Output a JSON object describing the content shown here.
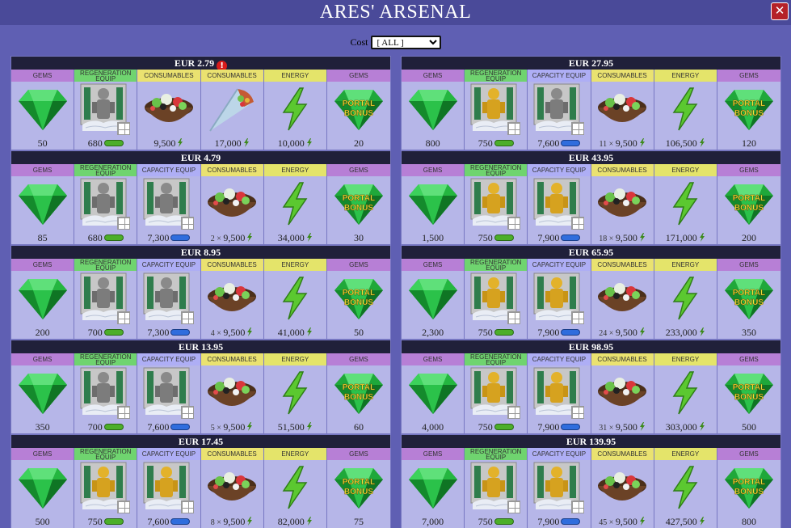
{
  "window": {
    "title": "ARES' ARSENAL",
    "close_glyph": "✕"
  },
  "filter": {
    "label": "Cost",
    "options": [
      "[ ALL ]"
    ],
    "selected": "[ ALL ]"
  },
  "columns": [
    {
      "kind": "gems",
      "label": "GEMS"
    },
    {
      "kind": "regen",
      "label": "REGENERATION EQUIP"
    },
    {
      "kind": "capacity",
      "label": "CAPACITY EQUIP"
    },
    {
      "kind": "consumables",
      "label": "CONSUMABLES"
    },
    {
      "kind": "energy",
      "label": "ENERGY"
    },
    {
      "kind": "portal",
      "label": "GEMS"
    }
  ],
  "portal_text": "PORTAL BONUS",
  "colors": {
    "header": "#20203a",
    "gems_head": "#b77fd6",
    "regen_head": "#6fd46f",
    "capacity_head": "#aeaef5",
    "consumables_head": "#eae270",
    "energy_head": "#e4e46a",
    "pill_green": "#4cae2a",
    "pill_blue": "#2f6ddd"
  },
  "bundles": [
    {
      "price": "EUR 2.79",
      "alert": "!",
      "layout": "special",
      "cells": [
        {
          "kind": "gems",
          "label": "GEMS",
          "value": "50",
          "icon": "gem-icon"
        },
        {
          "kind": "regen",
          "label": "REGENERATION EQUIP",
          "value": "680",
          "icon": "statue-silver-icon",
          "suffix": "pill-green"
        },
        {
          "kind": "consumables",
          "label": "CONSUMABLES",
          "value": "9,500",
          "icon": "salad-bowl-icon",
          "suffix": "bolt"
        },
        {
          "kind": "consumables",
          "label": "CONSUMABLES",
          "value": "17,000",
          "icon": "wrap-icon",
          "suffix": "bolt"
        },
        {
          "kind": "energy",
          "label": "ENERGY",
          "value": "10,000",
          "icon": "bolt-icon",
          "suffix": "bolt"
        },
        {
          "kind": "portal",
          "label": "GEMS",
          "value": "20",
          "icon": "portal-gem-icon"
        }
      ]
    },
    {
      "price": "EUR 27.95",
      "cells": [
        {
          "kind": "gems",
          "label": "GEMS",
          "value": "800",
          "icon": "gem-icon"
        },
        {
          "kind": "regen",
          "label": "REGENERATION EQUIP",
          "value": "750",
          "icon": "statue-gold-icon",
          "suffix": "pill-green"
        },
        {
          "kind": "capacity",
          "label": "CAPACITY EQUIP",
          "value": "7,600",
          "icon": "statue-silver-icon",
          "suffix": "pill-blue"
        },
        {
          "kind": "consumables",
          "label": "CONSUMABLES",
          "mult": "11 ×",
          "value": "9,500",
          "icon": "salad-bowl-icon",
          "suffix": "bolt"
        },
        {
          "kind": "energy",
          "label": "ENERGY",
          "value": "106,500",
          "icon": "bolt-icon",
          "suffix": "bolt"
        },
        {
          "kind": "portal",
          "label": "GEMS",
          "value": "120",
          "icon": "portal-gem-icon"
        }
      ]
    },
    {
      "price": "EUR 4.79",
      "cells": [
        {
          "kind": "gems",
          "label": "GEMS",
          "value": "85",
          "icon": "gem-icon"
        },
        {
          "kind": "regen",
          "label": "REGENERATION EQUIP",
          "value": "680",
          "icon": "statue-silver-icon",
          "suffix": "pill-green"
        },
        {
          "kind": "capacity",
          "label": "CAPACITY EQUIP",
          "value": "7,300",
          "icon": "statue-silver-icon",
          "suffix": "pill-blue"
        },
        {
          "kind": "consumables",
          "label": "CONSUMABLES",
          "mult": "2 ×",
          "value": "9,500",
          "icon": "salad-bowl-icon",
          "suffix": "bolt"
        },
        {
          "kind": "energy",
          "label": "ENERGY",
          "value": "34,000",
          "icon": "bolt-icon",
          "suffix": "bolt"
        },
        {
          "kind": "portal",
          "label": "GEMS",
          "value": "30",
          "icon": "portal-gem-icon"
        }
      ]
    },
    {
      "price": "EUR 43.95",
      "cells": [
        {
          "kind": "gems",
          "label": "GEMS",
          "value": "1,500",
          "icon": "gem-icon"
        },
        {
          "kind": "regen",
          "label": "REGENERATION EQUIP",
          "value": "750",
          "icon": "statue-gold-icon",
          "suffix": "pill-green"
        },
        {
          "kind": "capacity",
          "label": "CAPACITY EQUIP",
          "value": "7,900",
          "icon": "statue-gold-icon",
          "suffix": "pill-blue"
        },
        {
          "kind": "consumables",
          "label": "CONSUMABLES",
          "mult": "18 ×",
          "value": "9,500",
          "icon": "salad-bowl-icon",
          "suffix": "bolt"
        },
        {
          "kind": "energy",
          "label": "ENERGY",
          "value": "171,000",
          "icon": "bolt-icon",
          "suffix": "bolt"
        },
        {
          "kind": "portal",
          "label": "GEMS",
          "value": "200",
          "icon": "portal-gem-icon"
        }
      ]
    },
    {
      "price": "EUR 8.95",
      "cells": [
        {
          "kind": "gems",
          "label": "GEMS",
          "value": "200",
          "icon": "gem-icon"
        },
        {
          "kind": "regen",
          "label": "REGENERATION EQUIP",
          "value": "700",
          "icon": "statue-silver-icon",
          "suffix": "pill-green"
        },
        {
          "kind": "capacity",
          "label": "CAPACITY EQUIP",
          "value": "7,300",
          "icon": "statue-silver-icon",
          "suffix": "pill-blue"
        },
        {
          "kind": "consumables",
          "label": "CONSUMABLES",
          "mult": "4 ×",
          "value": "9,500",
          "icon": "salad-bowl-icon",
          "suffix": "bolt"
        },
        {
          "kind": "energy",
          "label": "ENERGY",
          "value": "41,000",
          "icon": "bolt-icon",
          "suffix": "bolt"
        },
        {
          "kind": "portal",
          "label": "GEMS",
          "value": "50",
          "icon": "portal-gem-icon"
        }
      ]
    },
    {
      "price": "EUR 65.95",
      "cells": [
        {
          "kind": "gems",
          "label": "GEMS",
          "value": "2,300",
          "icon": "gem-icon"
        },
        {
          "kind": "regen",
          "label": "REGENERATION EQUIP",
          "value": "750",
          "icon": "statue-gold-icon",
          "suffix": "pill-green"
        },
        {
          "kind": "capacity",
          "label": "CAPACITY EQUIP",
          "value": "7,900",
          "icon": "statue-gold-icon",
          "suffix": "pill-blue"
        },
        {
          "kind": "consumables",
          "label": "CONSUMABLES",
          "mult": "24 ×",
          "value": "9,500",
          "icon": "salad-bowl-icon",
          "suffix": "bolt"
        },
        {
          "kind": "energy",
          "label": "ENERGY",
          "value": "233,000",
          "icon": "bolt-icon",
          "suffix": "bolt"
        },
        {
          "kind": "portal",
          "label": "GEMS",
          "value": "350",
          "icon": "portal-gem-icon"
        }
      ]
    },
    {
      "price": "EUR 13.95",
      "cells": [
        {
          "kind": "gems",
          "label": "GEMS",
          "value": "350",
          "icon": "gem-icon"
        },
        {
          "kind": "regen",
          "label": "REGENERATION EQUIP",
          "value": "700",
          "icon": "statue-silver-icon",
          "suffix": "pill-green"
        },
        {
          "kind": "capacity",
          "label": "CAPACITY EQUIP",
          "value": "7,600",
          "icon": "statue-silver-icon",
          "suffix": "pill-blue"
        },
        {
          "kind": "consumables",
          "label": "CONSUMABLES",
          "mult": "5 ×",
          "value": "9,500",
          "icon": "salad-bowl-icon",
          "suffix": "bolt"
        },
        {
          "kind": "energy",
          "label": "ENERGY",
          "value": "51,500",
          "icon": "bolt-icon",
          "suffix": "bolt"
        },
        {
          "kind": "portal",
          "label": "GEMS",
          "value": "60",
          "icon": "portal-gem-icon"
        }
      ]
    },
    {
      "price": "EUR 98.95",
      "cells": [
        {
          "kind": "gems",
          "label": "GEMS",
          "value": "4,000",
          "icon": "gem-icon"
        },
        {
          "kind": "regen",
          "label": "REGENERATION EQUIP",
          "value": "750",
          "icon": "statue-gold-icon",
          "suffix": "pill-green"
        },
        {
          "kind": "capacity",
          "label": "CAPACITY EQUIP",
          "value": "7,900",
          "icon": "statue-gold-icon",
          "suffix": "pill-blue"
        },
        {
          "kind": "consumables",
          "label": "CONSUMABLES",
          "mult": "31 ×",
          "value": "9,500",
          "icon": "salad-bowl-icon",
          "suffix": "bolt"
        },
        {
          "kind": "energy",
          "label": "ENERGY",
          "value": "303,000",
          "icon": "bolt-icon",
          "suffix": "bolt"
        },
        {
          "kind": "portal",
          "label": "GEMS",
          "value": "500",
          "icon": "portal-gem-icon"
        }
      ]
    },
    {
      "price": "EUR 17.45",
      "cells": [
        {
          "kind": "gems",
          "label": "GEMS",
          "value": "500",
          "icon": "gem-icon"
        },
        {
          "kind": "regen",
          "label": "REGENERATION EQUIP",
          "value": "750",
          "icon": "statue-gold-icon",
          "suffix": "pill-green"
        },
        {
          "kind": "capacity",
          "label": "CAPACITY EQUIP",
          "value": "7,600",
          "icon": "statue-gold-icon",
          "suffix": "pill-blue"
        },
        {
          "kind": "consumables",
          "label": "CONSUMABLES",
          "mult": "8 ×",
          "value": "9,500",
          "icon": "salad-bowl-icon",
          "suffix": "bolt"
        },
        {
          "kind": "energy",
          "label": "ENERGY",
          "value": "82,000",
          "icon": "bolt-icon",
          "suffix": "bolt"
        },
        {
          "kind": "portal",
          "label": "GEMS",
          "value": "75",
          "icon": "portal-gem-icon"
        }
      ]
    },
    {
      "price": "EUR 139.95",
      "cells": [
        {
          "kind": "gems",
          "label": "GEMS",
          "value": "7,000",
          "icon": "gem-icon"
        },
        {
          "kind": "regen",
          "label": "REGENERATION EQUIP",
          "value": "750",
          "icon": "statue-gold-icon",
          "suffix": "pill-green"
        },
        {
          "kind": "capacity",
          "label": "CAPACITY EQUIP",
          "value": "7,900",
          "icon": "statue-gold-icon",
          "suffix": "pill-blue"
        },
        {
          "kind": "consumables",
          "label": "CONSUMABLES",
          "mult": "45 ×",
          "value": "9,500",
          "icon": "salad-bowl-icon",
          "suffix": "bolt"
        },
        {
          "kind": "energy",
          "label": "ENERGY",
          "value": "427,500",
          "icon": "bolt-icon",
          "suffix": "bolt"
        },
        {
          "kind": "portal",
          "label": "GEMS",
          "value": "800",
          "icon": "portal-gem-icon"
        }
      ]
    }
  ]
}
